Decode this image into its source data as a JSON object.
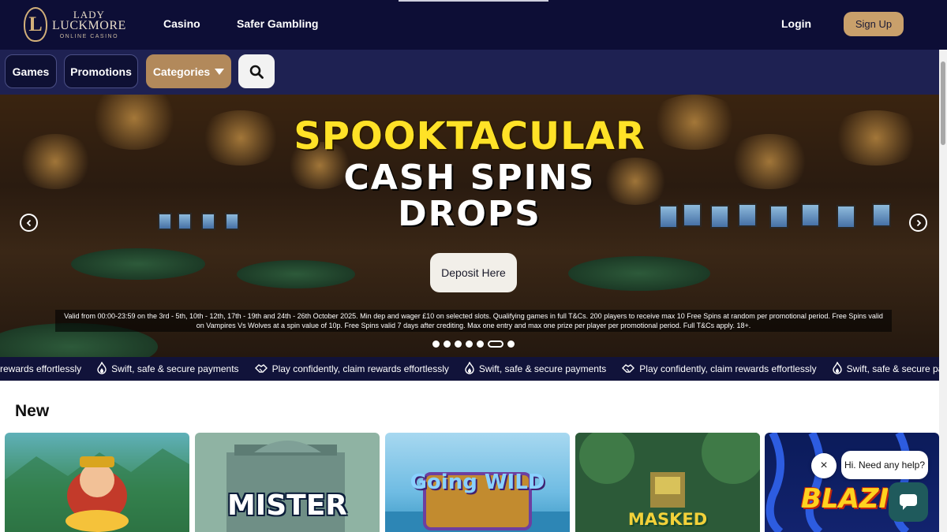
{
  "header": {
    "logo": {
      "line1": "LADY",
      "line2": "LUCKMORE",
      "line3": "ONLINE CASINO",
      "emblem": "L"
    },
    "nav": [
      {
        "label": "Casino"
      },
      {
        "label": "Safer Gambling"
      }
    ],
    "login_label": "Login",
    "signup_label": "Sign Up"
  },
  "subnav": {
    "games_label": "Games",
    "promotions_label": "Promotions",
    "categories_label": "Categories",
    "search_icon": "search-icon"
  },
  "hero": {
    "line1": "SPOOKTACULAR",
    "line2": "CASH SPINS",
    "line3": "DROPS",
    "cta_label": "Deposit Here",
    "terms": "Valid from 00:00-23:59 on the 3rd - 5th, 10th - 12th, 17th - 19th and 24th - 26th October 2025. Min dep and wager £10 on selected slots. Qualifying games in full T&Cs. 200 players to receive max 10 Free Spins at random per promotional period. Free Spins valid on Vampires Vs Wolves at a spin value of 10p. Free Spins valid 7 days after crediting. Max one entry and max one prize per player per promotional period. Full T&Cs apply. 18+.",
    "slides_total": 7,
    "slide_active_index": 5
  },
  "ticker": {
    "items": [
      {
        "icon": "handshake-icon",
        "text": "rewards effortlessly"
      },
      {
        "icon": "flame-icon",
        "text": "Swift, safe & secure payments"
      },
      {
        "icon": "handshake-icon",
        "text": "Play confidently, claim rewards effortlessly"
      },
      {
        "icon": "flame-icon",
        "text": "Swift, safe & secure payments"
      },
      {
        "icon": "handshake-icon",
        "text": "Play confidently, claim rewards effortlessly"
      },
      {
        "icon": "flame-icon",
        "text": "Swift, safe & secure payments"
      }
    ]
  },
  "new_section": {
    "title": "New",
    "games": [
      {
        "name": ""
      },
      {
        "name": "MISTER"
      },
      {
        "name": "Going WILD"
      },
      {
        "name": "MASKED"
      },
      {
        "name": "BLAZIN"
      }
    ]
  },
  "chat": {
    "greeting": "Hi. Need any help?",
    "close_label": "×"
  },
  "colors": {
    "header_bg": "#0d0e36",
    "subnav_bg": "#1e2152",
    "accent_gold": "#c9a06b",
    "spook_yellow": "#ffe227"
  }
}
